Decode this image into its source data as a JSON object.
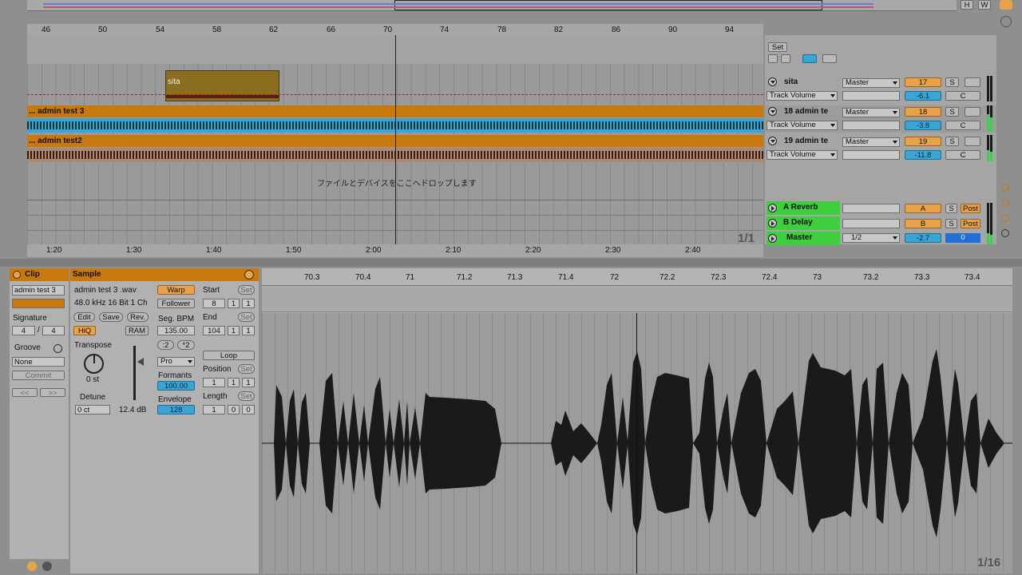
{
  "overview": {
    "h_button": "H",
    "w_button": "W"
  },
  "ruler": {
    "bars": [
      "46",
      "50",
      "54",
      "58",
      "62",
      "66",
      "70",
      "74",
      "78",
      "82",
      "86",
      "90",
      "94"
    ]
  },
  "timeline": {
    "times": [
      "1:20",
      "1:30",
      "1:40",
      "1:50",
      "2:00",
      "2:10",
      "2:20",
      "2:30",
      "2:40"
    ],
    "page": "1/1"
  },
  "set_button": "Set",
  "drop_hint": "ファイルとデバイスをここへドロップします",
  "clips": {
    "sita": "sita"
  },
  "tracks": [
    {
      "lane": "... admin test 3",
      "mixer_name": "18 admin te",
      "output": "Master",
      "number": "18",
      "volume": "-3.8",
      "pan": "C",
      "param": "Track Volume"
    },
    {
      "lane": "... admin test2",
      "mixer_name": "19 admin te",
      "output": "Master",
      "number": "19",
      "volume": "-11.8",
      "pan": "C",
      "param": "Track Volume"
    }
  ],
  "sita_track": {
    "mixer_name": "sita",
    "output": "Master",
    "number": "17",
    "volume": "-6.1",
    "pan": "C",
    "param": "Track Volume"
  },
  "returns": [
    {
      "name": "A Reverb",
      "letter": "A",
      "post": "Post"
    },
    {
      "name": "B Delay",
      "letter": "B",
      "post": "Post"
    }
  ],
  "master": {
    "name": "Master",
    "cue": "1/2",
    "volume": "-2.7",
    "pan": "0"
  },
  "mix_buttons": {
    "solo": "S"
  },
  "clip_panel": {
    "title": "Clip",
    "name": "admin test 3",
    "signature_label": "Signature",
    "sig_num": "4",
    "sig_sep": "/",
    "sig_den": "4",
    "groove_label": "Groove",
    "groove_value": "None",
    "commit": "Commit",
    "prev": "<<",
    "next": ">>"
  },
  "sample_panel": {
    "title": "Sample",
    "file": "admin test 3 .wav",
    "info": "48.0 kHz 16 Bit 1 Ch",
    "edit": "Edit",
    "save": "Save",
    "rev": "Rev.",
    "hiq": "HiQ",
    "ram": "RAM",
    "transpose_label": "Transpose",
    "transpose_value": "0 st",
    "detune_label": "Detune",
    "detune_value": "0 ct",
    "gain": "12.4 dB",
    "warp": "Warp",
    "follower": "Follower",
    "seg_bpm_label": "Seg. BPM",
    "seg_bpm": "135.00",
    "half": ":2",
    "double": "*2",
    "mode": "Pro",
    "formants_label": "Formants",
    "formants": "100.00",
    "envelope_label": "Envelope",
    "envelope": "128",
    "start_label": "Start",
    "set": "Set",
    "start": [
      "8",
      "1",
      "1"
    ],
    "end_label": "End",
    "end": [
      "104",
      "1",
      "1"
    ],
    "loop": "Loop",
    "position_label": "Position",
    "position": [
      "1",
      "1",
      "1"
    ],
    "length_label": "Length",
    "length": [
      "1",
      "0",
      "0"
    ]
  },
  "editor": {
    "bars": [
      "70.3",
      "70.4",
      "71",
      "71.2",
      "71.3",
      "71.4",
      "72",
      "72.2",
      "72.3",
      "72.4",
      "73",
      "73.2",
      "73.3",
      "73.4"
    ],
    "grid": "1/16"
  },
  "colors": {
    "accent": "#c7790e",
    "blue": "#37a6d6",
    "green": "#3ecf3e",
    "panel": "#b3b3b3"
  }
}
